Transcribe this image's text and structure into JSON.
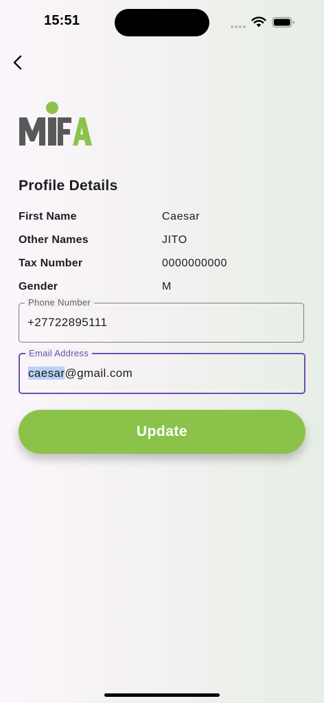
{
  "status_bar": {
    "time": "15:51"
  },
  "logo": {
    "text": "MIFA",
    "colors": {
      "gray": "#58595b",
      "green": "#8bc34a"
    }
  },
  "profile": {
    "title": "Profile Details",
    "rows": [
      {
        "label": "First Name",
        "value": "Caesar"
      },
      {
        "label": "Other Names",
        "value": "JITO"
      },
      {
        "label": "Tax Number",
        "value": "0000000000"
      },
      {
        "label": "Gender",
        "value": "M"
      }
    ]
  },
  "fields": {
    "phone": {
      "label": "Phone Number",
      "value": "+27722895111"
    },
    "email": {
      "label": "Email Address",
      "value_selected": "caesar",
      "value_rest": "@gmail.com"
    }
  },
  "actions": {
    "update_label": "Update"
  },
  "colors": {
    "accent": "#8bc34a",
    "focus": "#6a4fb3"
  }
}
